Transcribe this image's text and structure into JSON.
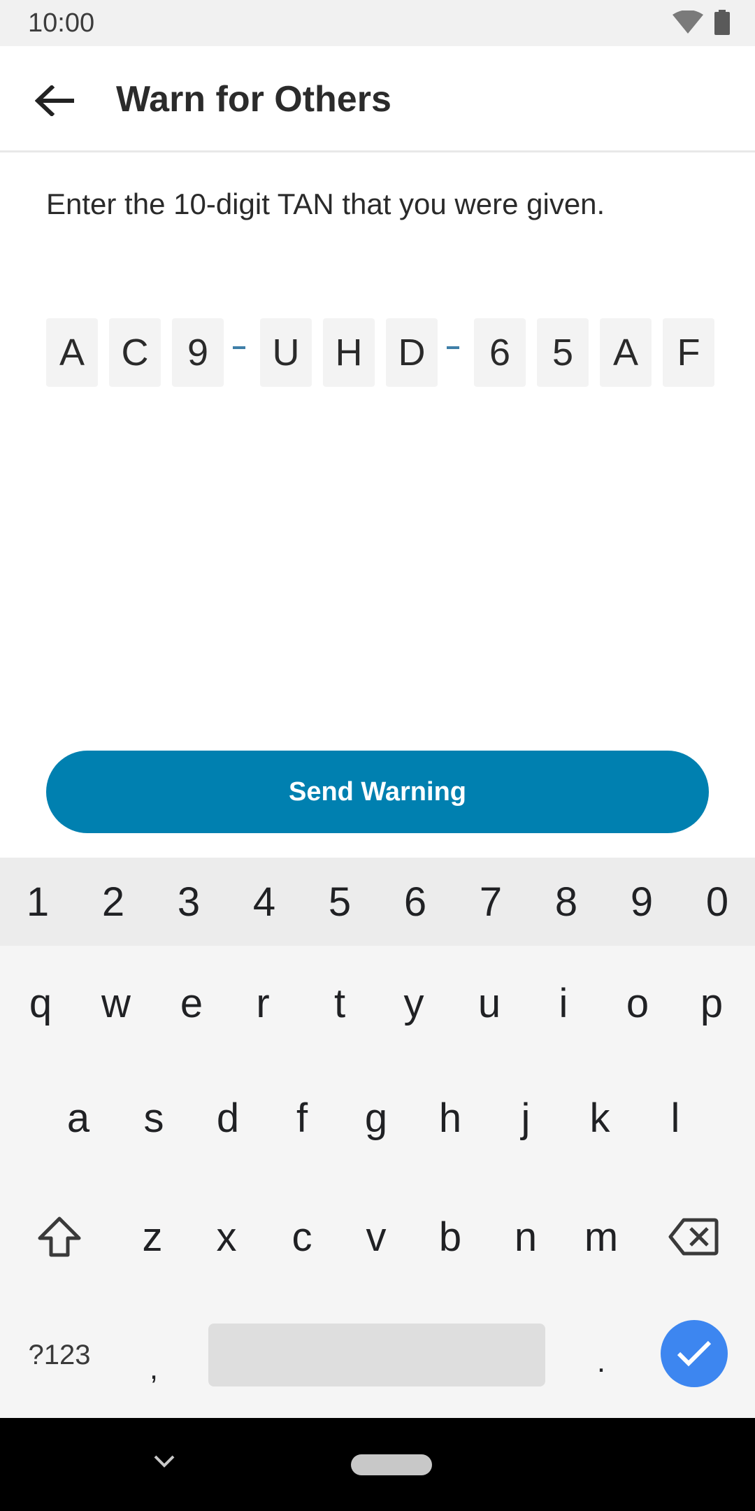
{
  "status_bar": {
    "time": "10:00"
  },
  "app_bar": {
    "title": "Warn for Others"
  },
  "instruction": "Enter the 10-digit TAN that you were given.",
  "tan": {
    "group1": [
      "A",
      "C",
      "9"
    ],
    "group2": [
      "U",
      "H",
      "D"
    ],
    "group3": [
      "6",
      "5",
      "A",
      "F"
    ]
  },
  "send_button": {
    "label": "Send Warning"
  },
  "keyboard": {
    "number_row": [
      "1",
      "2",
      "3",
      "4",
      "5",
      "6",
      "7",
      "8",
      "9",
      "0"
    ],
    "row1": [
      "q",
      "w",
      "e",
      "r",
      "t",
      "y",
      "u",
      "i",
      "o",
      "p"
    ],
    "row2": [
      "a",
      "s",
      "d",
      "f",
      "g",
      "h",
      "j",
      "k",
      "l"
    ],
    "row3": [
      "z",
      "x",
      "c",
      "v",
      "b",
      "n",
      "m"
    ],
    "symbols_label": "?123",
    "comma": ",",
    "period": "."
  },
  "colors": {
    "accent": "#0080b0",
    "keyboard_enter": "#3d86f0",
    "tan_separator": "#3f7fa8"
  }
}
